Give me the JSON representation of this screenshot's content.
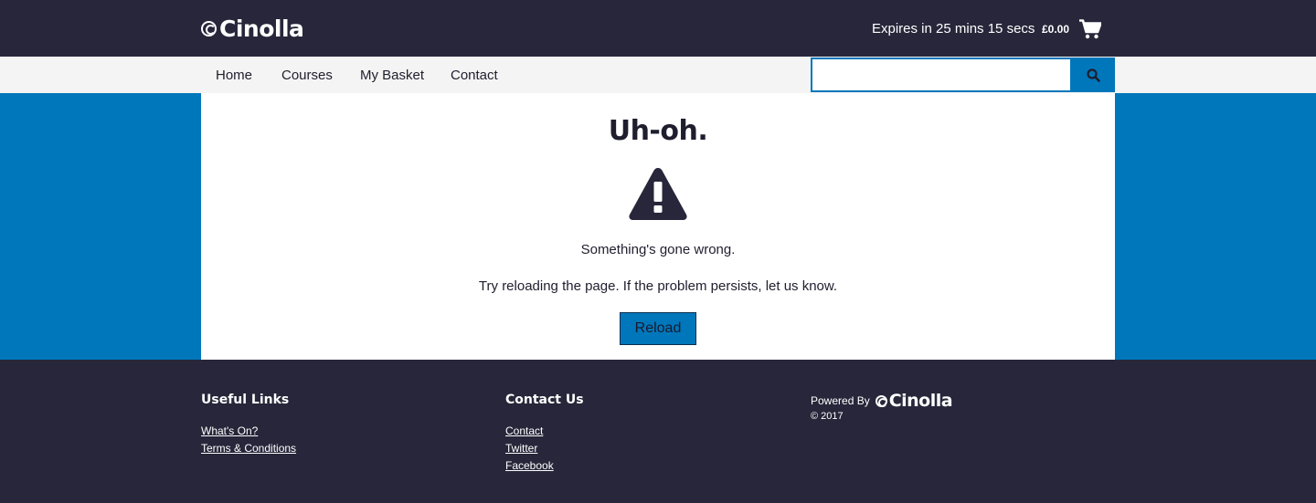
{
  "header": {
    "logo_text": "Cinolla",
    "expires": "Expires in 25 mins 15 secs",
    "basket_total": "£0.00",
    "cart_icon": "shopping-cart-icon"
  },
  "nav": {
    "items": [
      "Home",
      "Courses",
      "My Basket",
      "Contact"
    ],
    "search_placeholder": "",
    "search_icon": "search-icon"
  },
  "error": {
    "title": "Uh-oh.",
    "icon": "warning-icon",
    "message": "Something's gone wrong.",
    "hint": "Try reloading the page. If the problem persists, let us know.",
    "reload_label": "Reload"
  },
  "footer": {
    "useful_links": {
      "heading": "Useful Links",
      "links": [
        "What's On?",
        "Terms & Conditions"
      ]
    },
    "contact_us": {
      "heading": "Contact Us",
      "links": [
        "Contact",
        "Twitter",
        "Facebook"
      ]
    },
    "powered_by": "Powered By",
    "powered_logo": "Cinolla",
    "copyright": "© 2017"
  },
  "colors": {
    "dark": "#27263a",
    "accent": "#0077bb",
    "nav_bg": "#f4f4f4"
  }
}
